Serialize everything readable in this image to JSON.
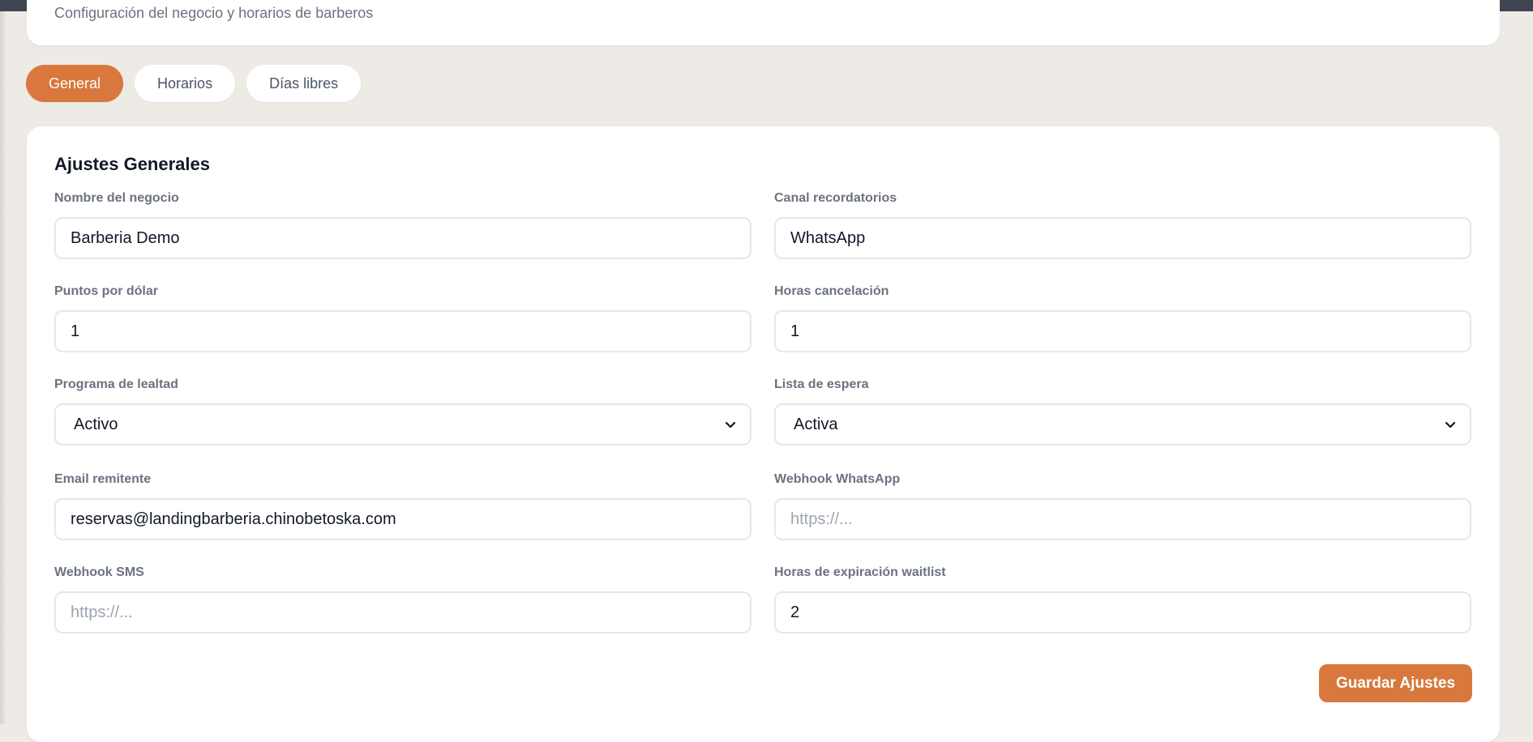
{
  "header": {
    "subtitle": "Configuración del negocio y horarios de barberos"
  },
  "tabs": [
    {
      "label": "General",
      "active": true
    },
    {
      "label": "Horarios",
      "active": false
    },
    {
      "label": "Días libres",
      "active": false
    }
  ],
  "settings": {
    "title": "Ajustes Generales",
    "business_name": {
      "label": "Nombre del negocio",
      "value": "Barberia Demo"
    },
    "reminder_channel": {
      "label": "Canal recordatorios",
      "value": "WhatsApp"
    },
    "points_per_dollar": {
      "label": "Puntos por dólar",
      "value": "1"
    },
    "cancel_hours": {
      "label": "Horas cancelación",
      "value": "1"
    },
    "loyalty_program": {
      "label": "Programa de lealtad",
      "value": "Activo"
    },
    "waitlist": {
      "label": "Lista de espera",
      "value": "Activa"
    },
    "sender_email": {
      "label": "Email remitente",
      "value": "reservas@landingbarberia.chinobetoska.com"
    },
    "whatsapp_webhook": {
      "label": "Webhook WhatsApp",
      "value": "",
      "placeholder": "https://..."
    },
    "sms_webhook": {
      "label": "Webhook SMS",
      "value": "",
      "placeholder": "https://..."
    },
    "waitlist_expiry_hours": {
      "label": "Horas de expiración waitlist",
      "value": "2"
    },
    "save_label": "Guardar Ajustes"
  },
  "colors": {
    "accent": "#d8783c",
    "background": "#eeebe6",
    "card": "#ffffff"
  },
  "icons": {
    "select_arrow": "chevron-down-icon"
  }
}
